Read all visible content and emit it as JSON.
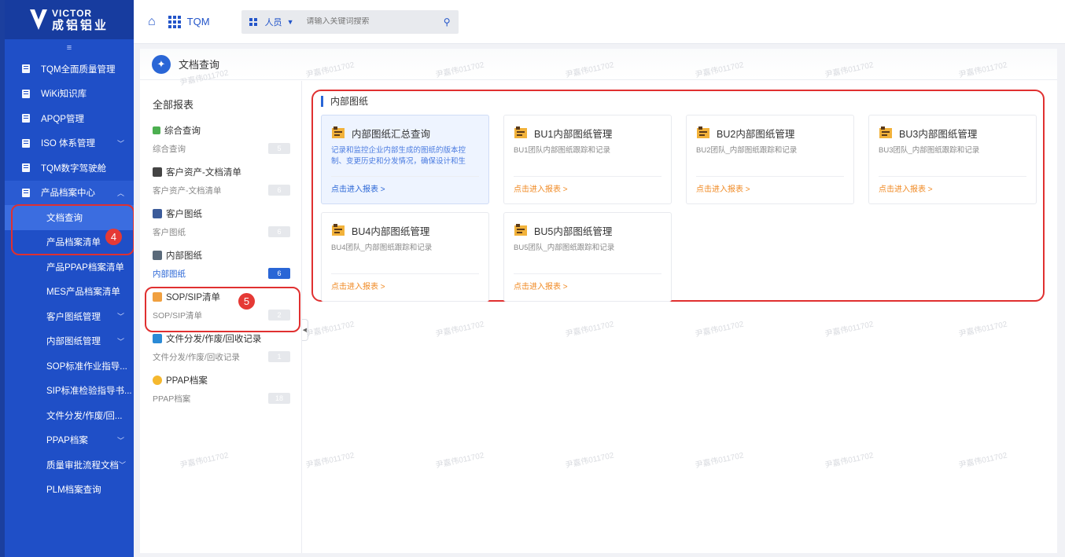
{
  "logo": {
    "en": "VICTOR",
    "cn": "成铝铝业"
  },
  "sidebar": {
    "collapse_icon": "≡",
    "items": [
      {
        "label": "TQM全面质量管理"
      },
      {
        "label": "WiKi知识库"
      },
      {
        "label": "APQP管理"
      },
      {
        "label": "ISO 体系管理"
      },
      {
        "label": "TQM数字驾驶舱"
      },
      {
        "label": "产品档案中心"
      }
    ],
    "subitems": [
      {
        "label": "文档查询"
      },
      {
        "label": "产品档案清单"
      },
      {
        "label": "产品PPAP档案清单"
      },
      {
        "label": "MES产品档案清单"
      },
      {
        "label": "客户图纸管理"
      },
      {
        "label": "内部图纸管理"
      },
      {
        "label": "SOP标准作业指导..."
      },
      {
        "label": "SIP标准检验指导书..."
      },
      {
        "label": "文件分发/作废/回..."
      },
      {
        "label": "PPAP档案"
      },
      {
        "label": "质量审批流程文档"
      },
      {
        "label": "PLM档案查询"
      }
    ],
    "annotation_4": "4"
  },
  "topbar": {
    "app_name": "TQM",
    "search_scope": "人员",
    "search_placeholder": "请输入关键词搜索"
  },
  "page": {
    "title": "文档查询",
    "all_reports": "全部报表",
    "groups": [
      {
        "title": "综合查询",
        "item": "综合查询",
        "count": "5",
        "icon_color": "#4caf50"
      },
      {
        "title": "客户资产-文档清单",
        "item": "客户资产-文档清单",
        "count": "6",
        "icon_color": "#444444"
      },
      {
        "title": "客户图纸",
        "item": "客户图纸",
        "count": "6",
        "icon_color": "#3b5b9a"
      },
      {
        "title": "内部图纸",
        "item": "内部图纸",
        "count": "6",
        "icon_color": "#5a6a7a"
      },
      {
        "title": "SOP/SIP清单",
        "item": "SOP/SIP清单",
        "count": "2",
        "icon_color": "#f0a040"
      },
      {
        "title": "文件分发/作废/回收记录",
        "item": "文件分发/作废/回收记录",
        "count": "1",
        "icon_color": "#2a8ad6"
      },
      {
        "title": "PPAP档案",
        "item": "PPAP档案",
        "count": "18",
        "icon_color": "#f5b82e"
      }
    ],
    "annotation_5": "5",
    "section_title": "内部图纸",
    "cards": [
      {
        "title": "内部图纸汇总查询",
        "desc": "记录和监控企业内部生成的图纸的版本控制、变更历史和分发情况，确保设计和生",
        "link": "点击进入报表 >"
      },
      {
        "title": "BU1内部图纸管理",
        "desc": "BU1团队内部图纸跟踪和记录",
        "link": "点击进入报表 >"
      },
      {
        "title": "BU2内部图纸管理",
        "desc": "BU2团队_内部图纸跟踪和记录",
        "link": "点击进入报表 >"
      },
      {
        "title": "BU3内部图纸管理",
        "desc": "BU3团队_内部图纸跟踪和记录",
        "link": "点击进入报表 >"
      },
      {
        "title": "BU4内部图纸管理",
        "desc": "BU4团队_内部图纸跟踪和记录",
        "link": "点击进入报表 >"
      },
      {
        "title": "BU5内部图纸管理",
        "desc": "BU5团队_内部图纸跟踪和记录",
        "link": "点击进入报表 >"
      }
    ],
    "watermark": "尹嘉伟011702"
  },
  "colors": {
    "sidebar": "#1f4fc7",
    "accent": "#2a66d6",
    "link": "#f08a24",
    "annotation": "#e03030"
  }
}
